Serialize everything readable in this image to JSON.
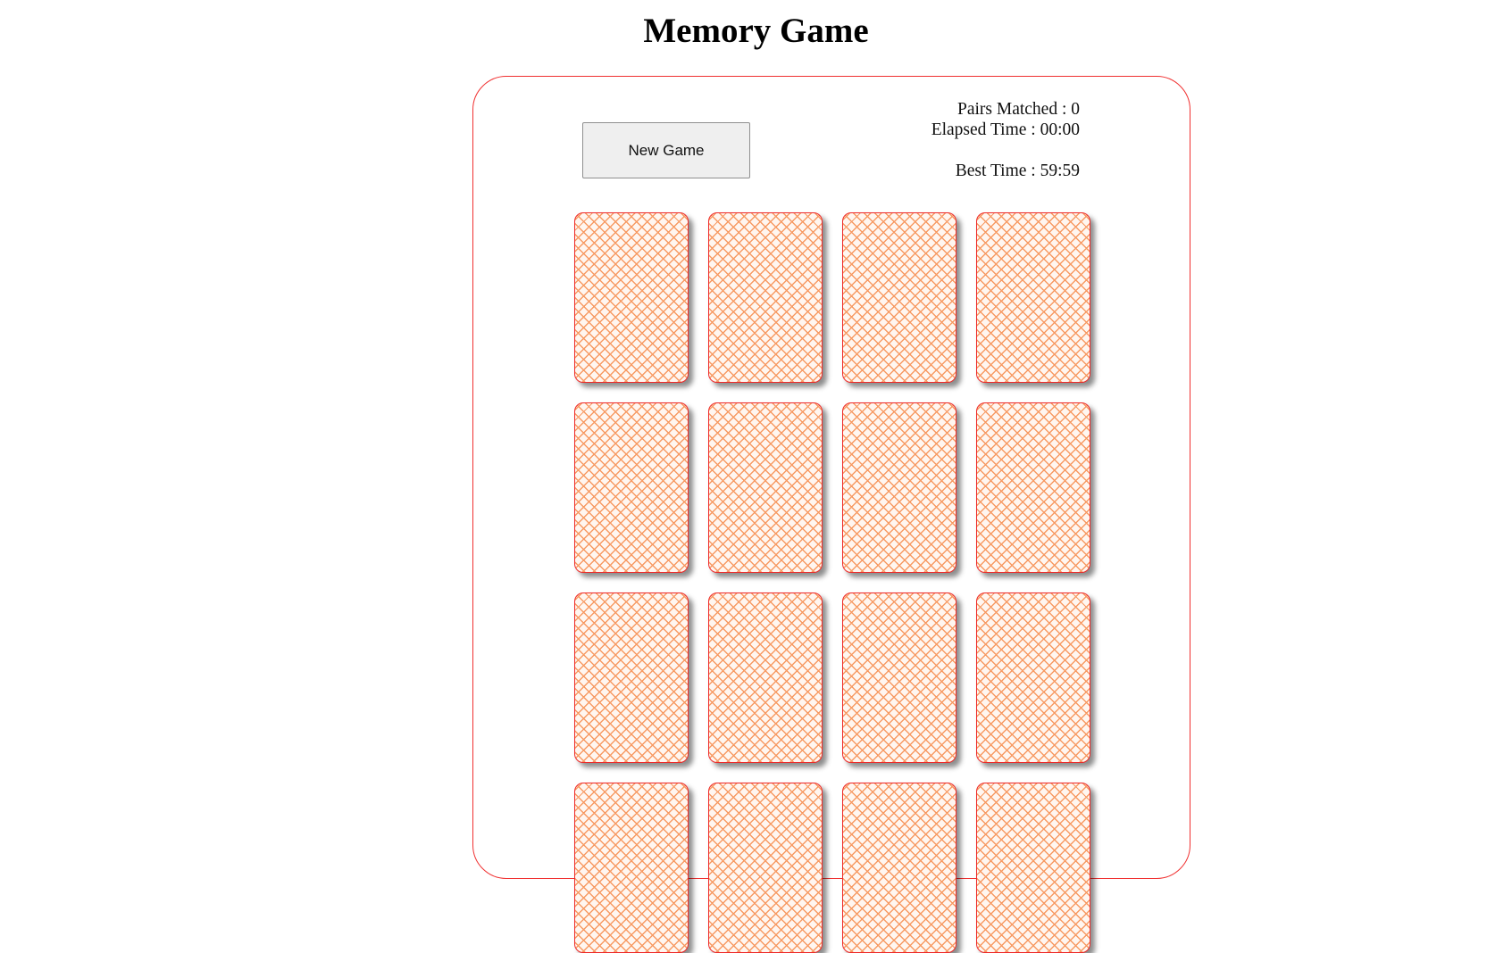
{
  "title": "Memory Game",
  "controls": {
    "new_game_label": "New Game"
  },
  "stats": {
    "pairs_matched": "Pairs Matched : 0",
    "elapsed_time": "Elapsed Time : 00:00",
    "best_time": "Best Time : 59:59"
  },
  "board": {
    "card_count_visible": 16,
    "columns": 4,
    "cards_state": "face-down",
    "card_back_color": "#f79a63",
    "card_border_color": "#ee2a2a",
    "board_border_color": "#f03030"
  }
}
